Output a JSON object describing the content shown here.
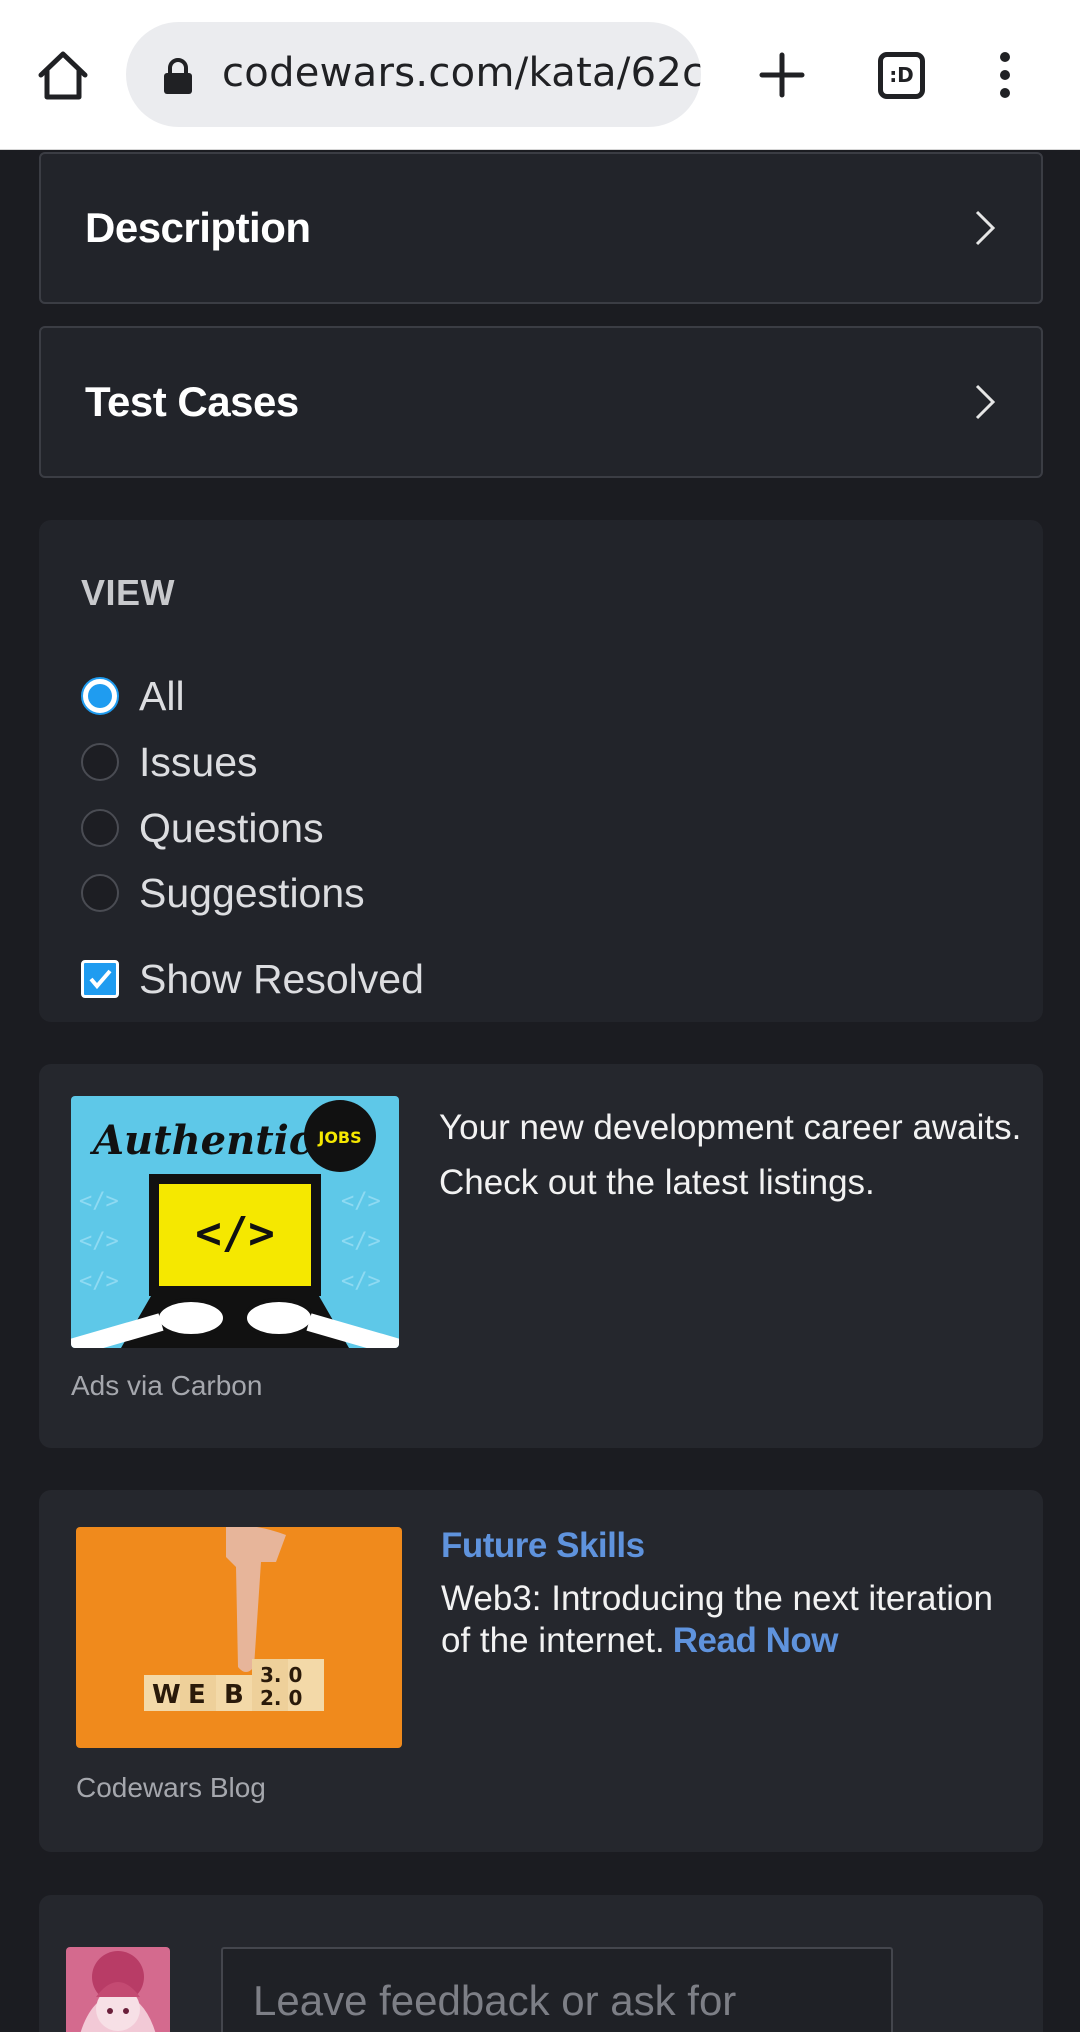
{
  "browser": {
    "url": "codewars.com/kata/62c",
    "tab_count_icon": ":D"
  },
  "panels": {
    "description": "Description",
    "test_cases": "Test Cases"
  },
  "view": {
    "title": "VIEW",
    "options": [
      "All",
      "Issues",
      "Questions",
      "Suggestions"
    ],
    "selected": "All",
    "show_resolved_label": "Show Resolved",
    "show_resolved_checked": true
  },
  "ad": {
    "image_brand": "Authentic",
    "image_badge": "JOBS",
    "image_code": "</>",
    "text": "Your new development career awaits. Check out the latest listings.",
    "source": "Ads via Carbon"
  },
  "blog": {
    "heading": "Future Skills",
    "text": "Web3: Introducing the next iteration of the internet.",
    "link": "Read Now",
    "source": "Codewars Blog",
    "image_letters": [
      "W",
      "E",
      "B"
    ],
    "image_version_top": "3. 0",
    "image_version_bottom": "2. 0"
  },
  "feedback": {
    "placeholder": "Leave feedback or ask for help..."
  },
  "colors": {
    "accent_blue": "#1f9cf0",
    "link_blue": "#5f93dd",
    "page_bg": "#1b1c21",
    "card_bg": "#22242a"
  }
}
